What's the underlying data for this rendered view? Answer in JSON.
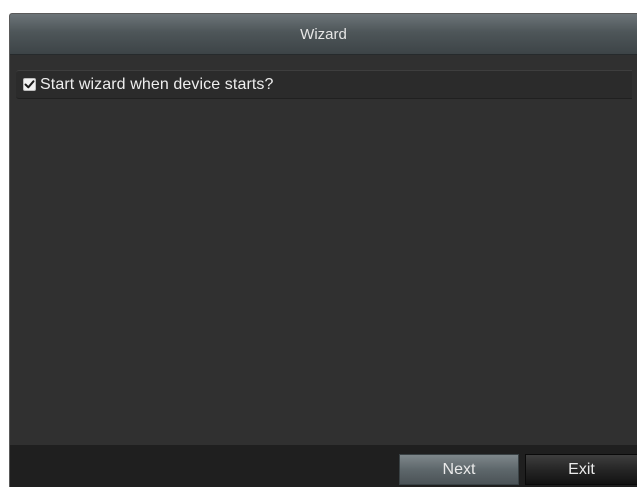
{
  "window": {
    "title": "Wizard"
  },
  "options": {
    "start_wizard": {
      "label": "Start wizard when device starts?",
      "checked": true
    }
  },
  "footer": {
    "next_label": "Next",
    "exit_label": "Exit"
  },
  "colors": {
    "background": "#303030",
    "footer": "#1f1f1f",
    "text": "#eeeeee",
    "next_button": "#5e676b",
    "exit_button": "#262626"
  },
  "icons": {
    "checkbox": "checkmark-icon"
  }
}
